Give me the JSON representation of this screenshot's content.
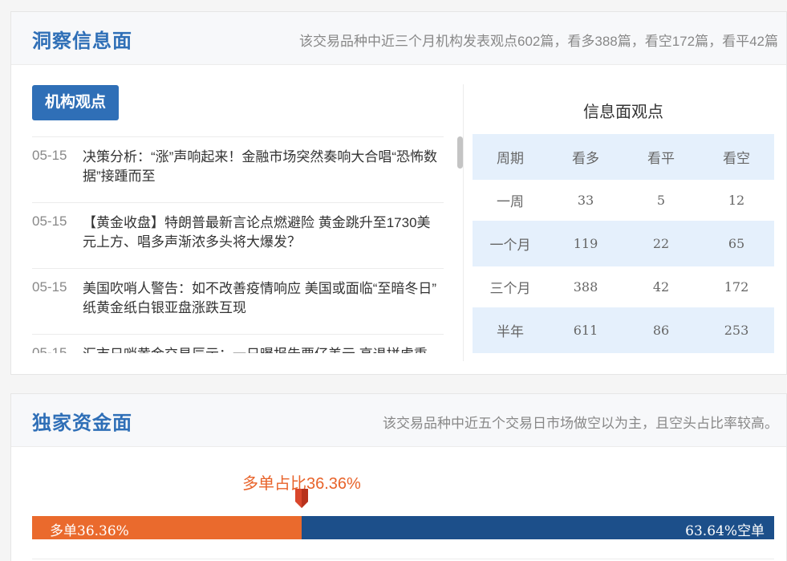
{
  "info_section": {
    "title": "洞察信息面",
    "summary": "该交易品种中近三个月机构发表观点602篇，看多388篇，看空172篇，看平42篇",
    "tab_label": "机构观点",
    "news": [
      {
        "date": "05-15",
        "text": "决策分析：“涨”声响起来！金融市场突然奏响大合唱“恐怖数据”接踵而至"
      },
      {
        "date": "05-15",
        "text": "【黄金收盘】特朗普最新言论点燃避险 黄金跳升至1730美元上方、唱多声渐浓多头将大爆发？"
      },
      {
        "date": "05-15",
        "text": "美国吹哨人警告：如不改善疫情响应 美国或面临“至暗冬日” 纸黄金纸白银亚盘涨跌互现"
      },
      {
        "date": "05-15",
        "text": "汇市日哨黄金交易辰示：一日曝报告要仔美元 高退拼虑重"
      }
    ],
    "table": {
      "title": "信息面观点",
      "headers": [
        "周期",
        "看多",
        "看平",
        "看空"
      ],
      "rows": [
        [
          "一周",
          "33",
          "5",
          "12"
        ],
        [
          "一个月",
          "119",
          "22",
          "65"
        ],
        [
          "三个月",
          "388",
          "42",
          "172"
        ],
        [
          "半年",
          "611",
          "86",
          "253"
        ]
      ]
    }
  },
  "fund_section": {
    "title": "独家资金面",
    "summary": "该交易品种中近五个交易日市场做空以为主，且空头占比率较高。",
    "marker_label": "多单占比36.36%",
    "long_label": "多单36.36%",
    "short_label": "63.64%空单",
    "long_ratio": 0.3636,
    "colors": {
      "long": "#ea6a2d",
      "short": "#1c4f8a",
      "accent": "#2f6fb7"
    }
  }
}
